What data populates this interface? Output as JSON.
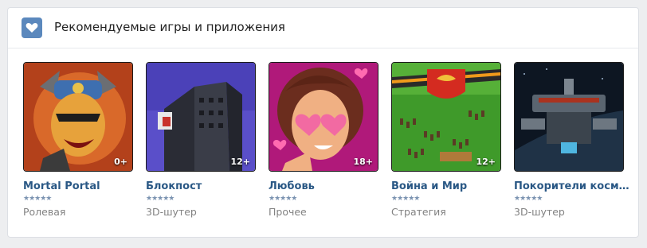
{
  "section": {
    "title": "Рекомендуемые игры и приложения",
    "icon": "heart-icon",
    "accent": "#5b88bd"
  },
  "games": [
    {
      "name": "Mortal Portal",
      "genre": "Ролевая",
      "age": "0+",
      "rating_stars": "★★★★★"
    },
    {
      "name": "Блокпост",
      "genre": "3D-шутер",
      "age": "12+",
      "rating_stars": "★★★★★"
    },
    {
      "name": "Любовь",
      "genre": "Прочее",
      "age": "18+",
      "rating_stars": "★★★★★"
    },
    {
      "name": "Война и Мир",
      "genre": "Стратегия",
      "age": "12+",
      "rating_stars": "★★★★★"
    },
    {
      "name": "Покорители космо...",
      "genre": "3D-шутер",
      "age": "",
      "rating_stars": "★★★★★"
    }
  ]
}
